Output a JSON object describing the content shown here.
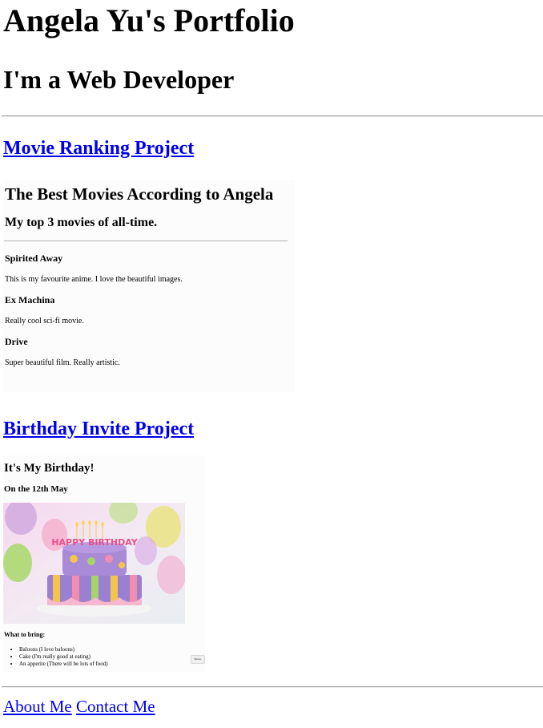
{
  "header": {
    "title": "Angela Yu's Portfolio",
    "subtitle": "I'm a Web Developer"
  },
  "projects": {
    "movie": {
      "link_label": "Movie Ranking Project",
      "preview": {
        "heading": "The Best Movies According to Angela",
        "subheading": "My top 3 movies of all-time.",
        "movies": [
          {
            "title": "Spirited Away",
            "description": "This is my favourite anime. I love the beautiful images."
          },
          {
            "title": "Ex Machina",
            "description": "Really cool sci-fi movie."
          },
          {
            "title": "Drive",
            "description": "Super beautiful film. Really artistic."
          }
        ]
      }
    },
    "birthday": {
      "link_label": "Birthday Invite Project",
      "preview": {
        "heading": "It's My Birthday!",
        "date": "On the 12th May",
        "cake_text": "HAPPY BIRTHDAY",
        "bring_label": "What to bring:",
        "items": [
          "Baloons (I love baloons)",
          "Cake (I'm really good at eating)",
          "An apperite (There will be lots of food)"
        ],
        "button_label": "Button"
      }
    }
  },
  "footer": {
    "about_label": "About Me",
    "contact_label": "Contact Me"
  },
  "colors": {
    "link": "#0000ee",
    "text": "#000000",
    "background": "#ffffff"
  }
}
